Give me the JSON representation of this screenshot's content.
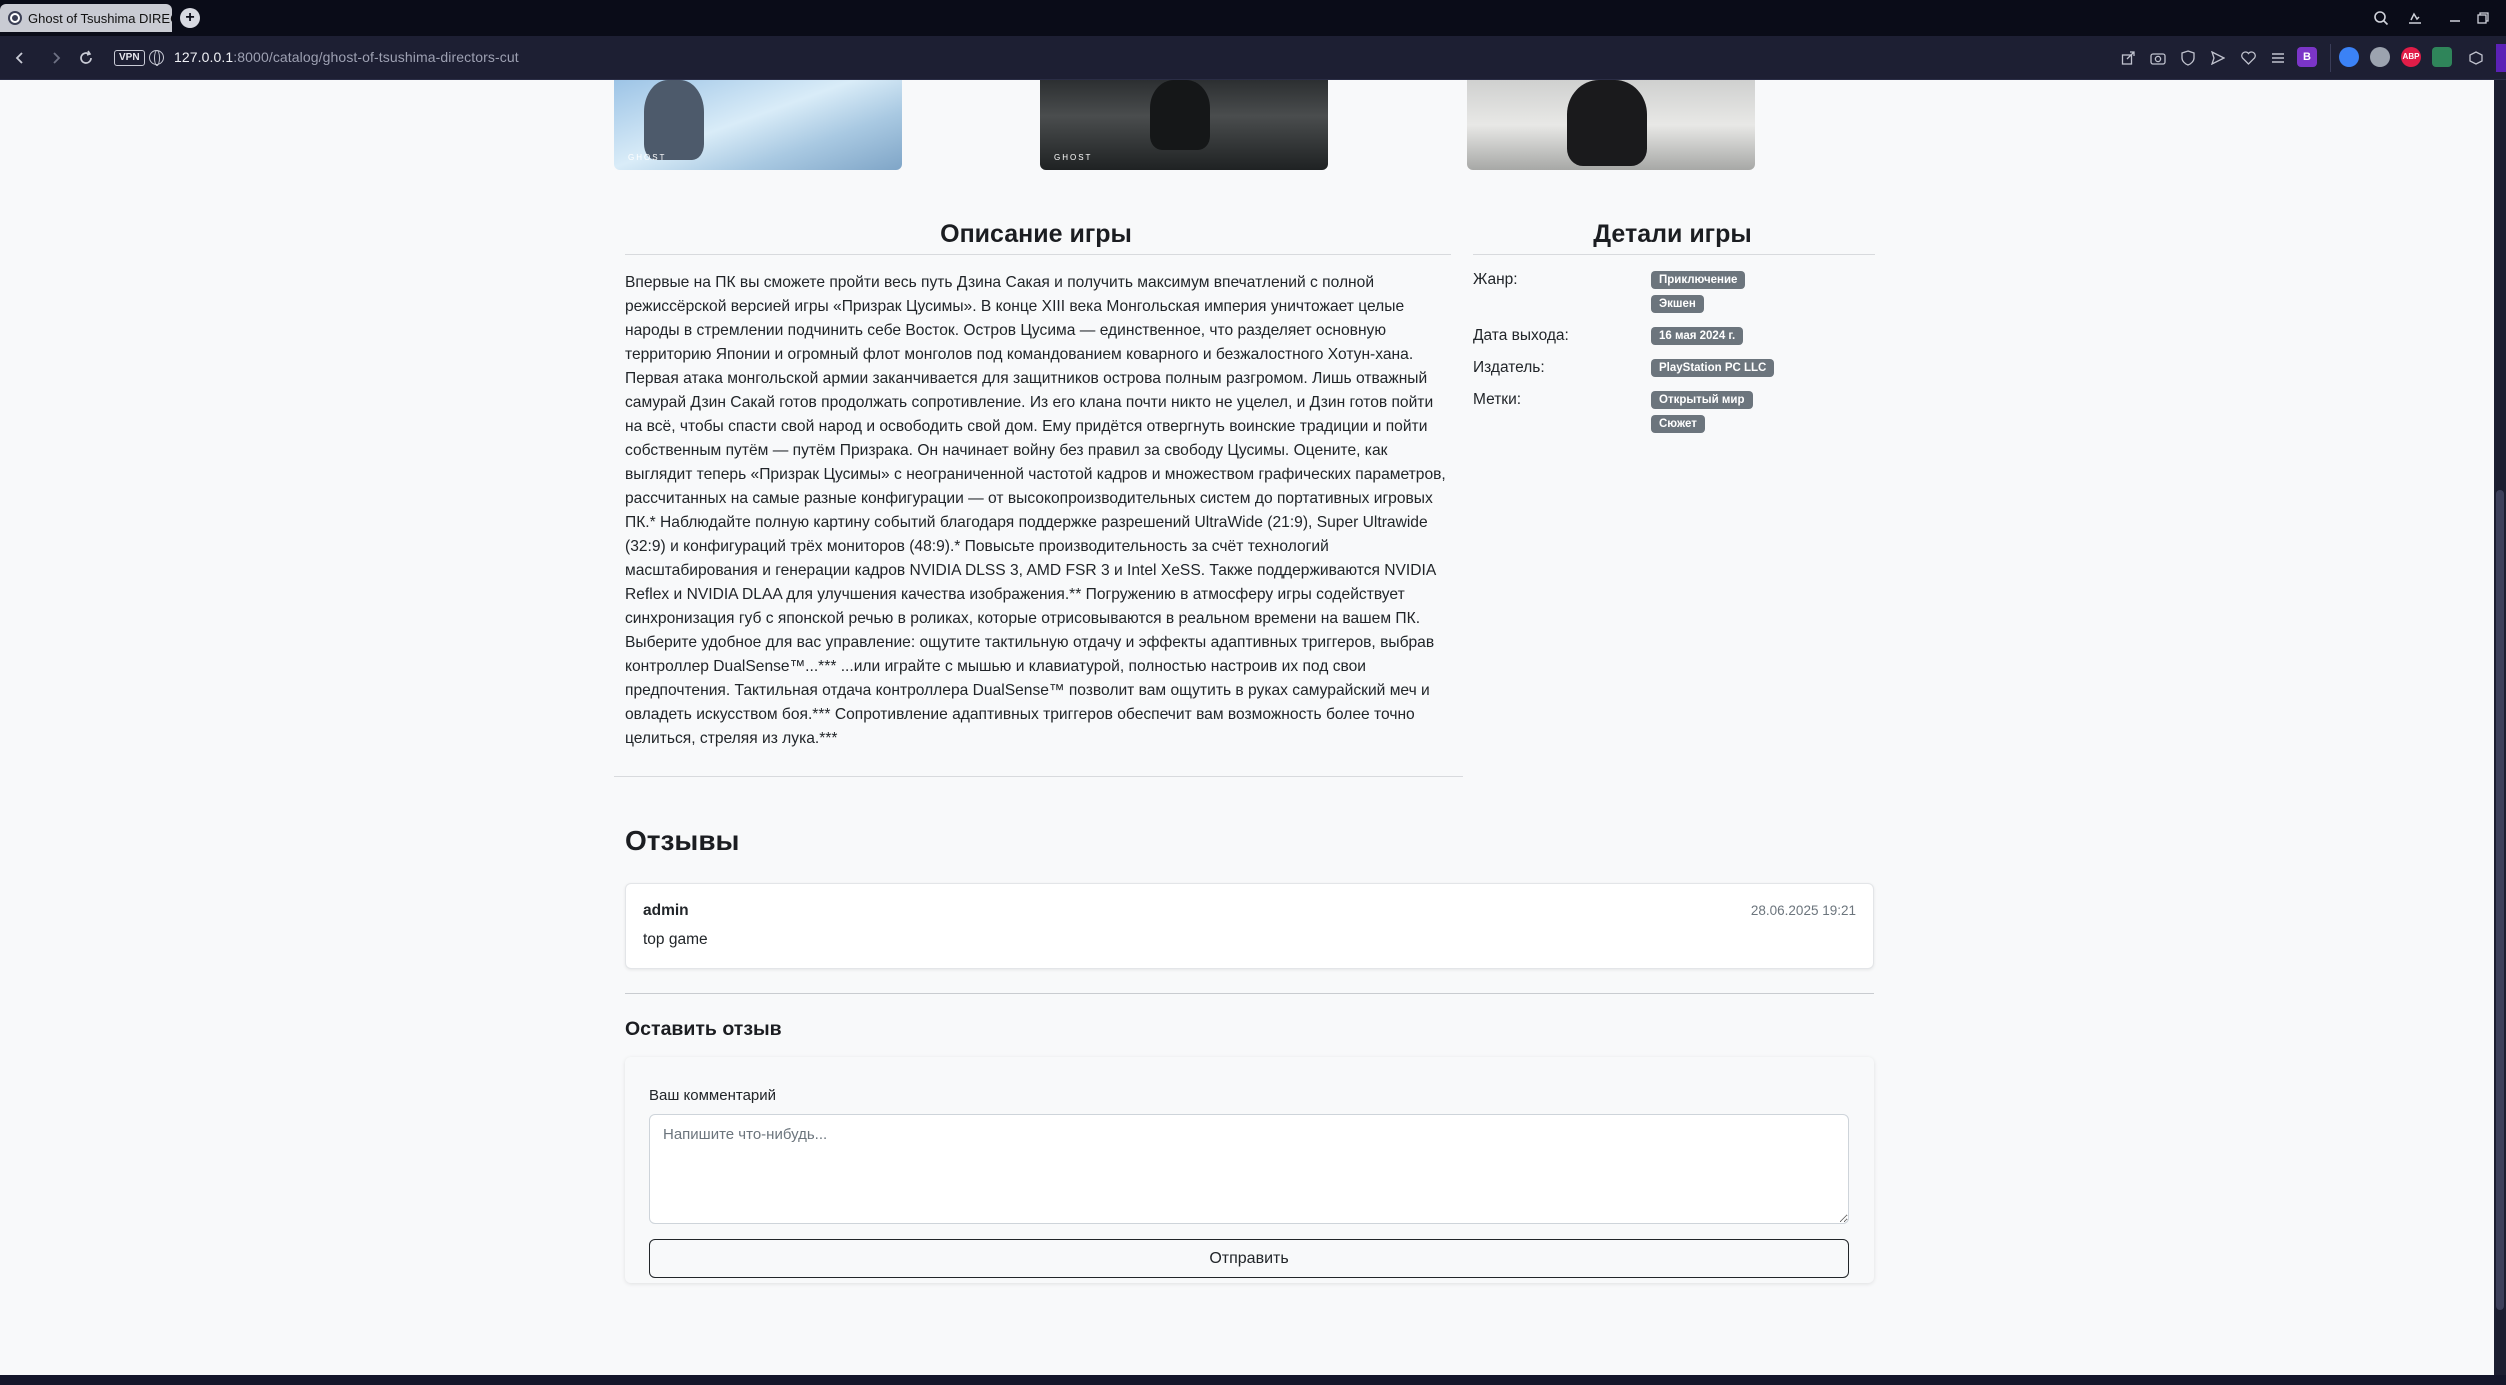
{
  "browser": {
    "tab_title": "Ghost of Tsushima DIRECT",
    "new_tab_symbol": "+",
    "vpn_label": "VPN",
    "url_host": "127.0.0.1",
    "url_path": ":8000/catalog/ghost-of-tsushima-directors-cut",
    "profile_letter": "B",
    "adblock_label": "ABP"
  },
  "screenshots": [
    {
      "logo": "GHOST"
    },
    {
      "logo": "GHOST"
    },
    {
      "logo": ""
    }
  ],
  "description": {
    "heading": "Описание игры",
    "text": "Впервые на ПК вы сможете пройти весь путь Дзина Сакая и получить максимум впечатлений с полной режиссёрской версией игры «Призрак Цусимы». В конце XIII века Монгольская империя уничтожает целые народы в стремлении подчинить себе Восток. Остров Цусима — единственное, что разделяет основную территорию Японии и огромный флот монголов под командованием коварного и безжалостного Хотун-хана. Первая атака монгольской армии заканчивается для защитников острова полным разгромом. Лишь отважный самурай Дзин Сакай готов продолжать сопротивление. Из его клана почти никто не уцелел, и Дзин готов пойти на всё, чтобы спасти свой народ и освободить свой дом. Ему придётся отвергнуть воинские традиции и пойти собственным путём — путём Призрака. Он начинает войну без правил за свободу Цусимы. Оцените, как выглядит теперь «Призрак Цусимы» с неограниченной частотой кадров и множеством графических параметров, рассчитанных на самые разные конфигурации — от высокопроизводительных систем до портативных игровых ПК.* Наблюдайте полную картину событий благодаря поддержке разрешений UltraWide (21:9), Super Ultrawide (32:9) и конфигураций трёх мониторов (48:9).* Повысьте производительность за счёт технологий масштабирования и генерации кадров NVIDIA DLSS 3, AMD FSR 3 и Intel XeSS. Также поддерживаются NVIDIA Reflex и NVIDIA DLAA для улучшения качества изображения.** Погружению в атмосферу игры содействует синхронизация губ с японской речью в роликах, которые отрисовываются в реальном времени на вашем ПК. Выберите удобное для вас управление: ощутите тактильную отдачу и эффекты адаптивных триггеров, выбрав контроллер DualSense™...*** ...или играйте с мышью и клавиатурой, полностью настроив их под свои предпочтения. Тактильная отдача контроллера DualSense™ позволит вам ощутить в руках самурайский меч и овладеть искусством боя.*** Сопротивление адаптивных триггеров обеспечит вам возможность более точно целиться, стреляя из лука.***"
  },
  "details": {
    "heading": "Детали игры",
    "genre_label": "Жанр:",
    "genres": [
      "Приключение",
      "Экшен"
    ],
    "release_label": "Дата выхода:",
    "release_date": "16 мая 2024 г.",
    "publisher_label": "Издатель:",
    "publisher": "PlayStation PC LLC",
    "tags_label": "Метки:",
    "tags": [
      "Открытый мир",
      "Сюжет"
    ]
  },
  "reviews": {
    "heading": "Отзывы",
    "items": [
      {
        "user": "admin",
        "date": "28.06.2025 19:21",
        "text": "top game"
      }
    ]
  },
  "review_form": {
    "heading": "Оставить отзыв",
    "label": "Ваш комментарий",
    "placeholder": "Напишите что-нибудь...",
    "submit": "Отправить"
  },
  "colors": {
    "badge": "#6c757d",
    "page_bg": "#f8f9fa",
    "chrome_bg": "#1d1f33"
  }
}
